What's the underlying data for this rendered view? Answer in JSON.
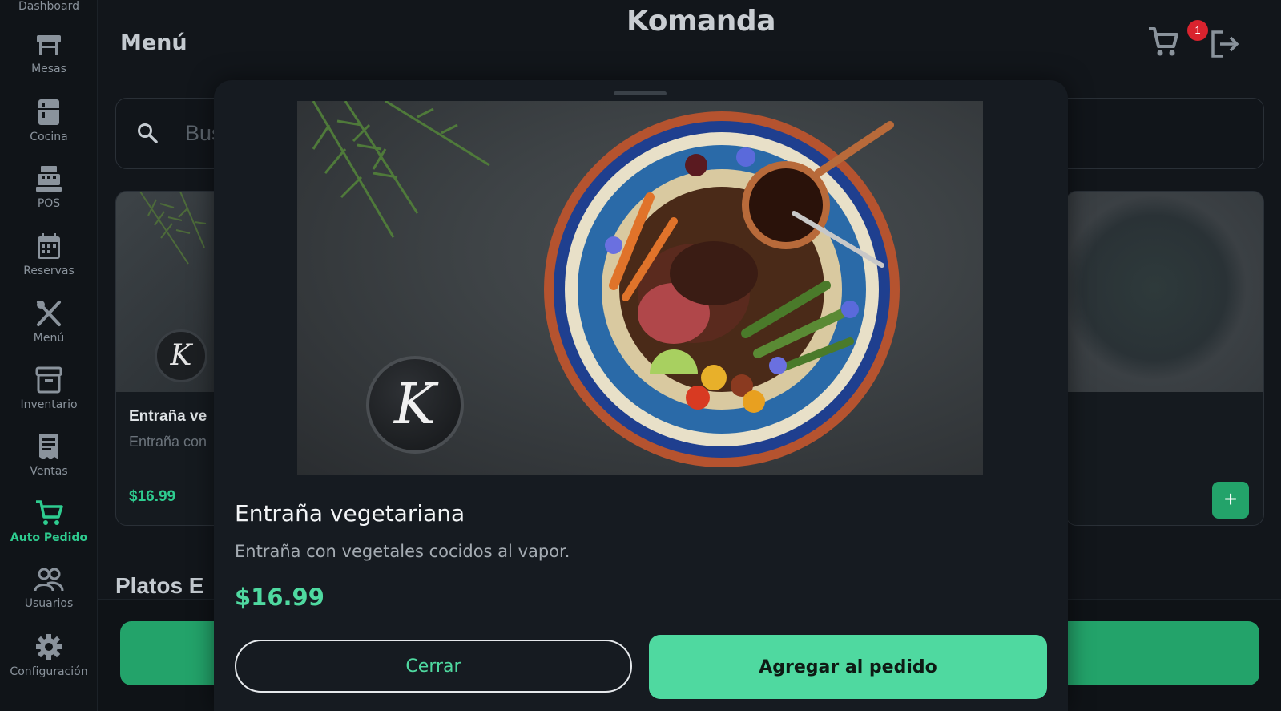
{
  "sidebar": {
    "top_label": "Dashboard",
    "items": [
      {
        "label": "Mesas",
        "icon": "table-icon"
      },
      {
        "label": "Cocina",
        "icon": "fridge-icon"
      },
      {
        "label": "POS",
        "icon": "cash-register-icon"
      },
      {
        "label": "Reservas",
        "icon": "calendar-icon"
      },
      {
        "label": "Menú",
        "icon": "utensils-icon"
      },
      {
        "label": "Inventario",
        "icon": "archive-box-icon"
      },
      {
        "label": "Ventas",
        "icon": "receipt-icon"
      },
      {
        "label": "Auto Pedido",
        "icon": "cart-icon",
        "active": true
      },
      {
        "label": "Usuarios",
        "icon": "users-icon"
      },
      {
        "label": "Configuración",
        "icon": "gear-icon"
      }
    ],
    "active_color": "#2ecc8f"
  },
  "header": {
    "title": "Menú",
    "logo": "Komanda",
    "cart_count": "1"
  },
  "search": {
    "placeholder": "Bus"
  },
  "background": {
    "card_title": "Entraña ve",
    "card_desc": "Entraña con",
    "card_price": "$16.99",
    "card_badge": "K",
    "add_label": "+",
    "section_title": "Platos E"
  },
  "modal": {
    "badge": "K",
    "title": "Entraña vegetariana",
    "description": "Entraña con vegetales cocidos al vapor.",
    "price": "$16.99",
    "close_label": "Cerrar",
    "add_label": "Agregar al pedido",
    "accent": "#4fd9a0"
  }
}
